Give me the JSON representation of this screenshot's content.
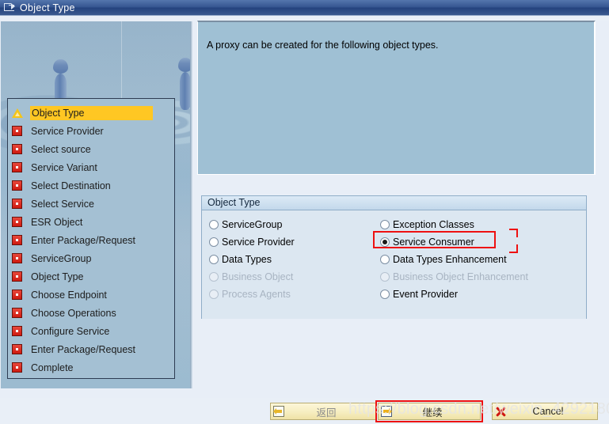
{
  "window": {
    "title": "Object Type",
    "title_icon": "document-arrow-icon"
  },
  "description": {
    "text": "A proxy can be created for the following object types."
  },
  "sidebar": {
    "steps": [
      {
        "label": "Object Type",
        "icon": "warning-triangle-icon",
        "state": "current"
      },
      {
        "label": "Service Provider",
        "icon": "red-square-icon",
        "state": "pending"
      },
      {
        "label": "Select source",
        "icon": "red-square-icon",
        "state": "pending"
      },
      {
        "label": "Service Variant",
        "icon": "red-square-icon",
        "state": "pending"
      },
      {
        "label": "Select Destination",
        "icon": "red-square-icon",
        "state": "pending"
      },
      {
        "label": "Select Service",
        "icon": "red-square-icon",
        "state": "pending"
      },
      {
        "label": "ESR Object",
        "icon": "red-square-icon",
        "state": "pending"
      },
      {
        "label": "Enter Package/Request",
        "icon": "red-square-icon",
        "state": "pending"
      },
      {
        "label": "ServiceGroup",
        "icon": "red-square-icon",
        "state": "pending"
      },
      {
        "label": "Object Type",
        "icon": "red-square-icon",
        "state": "pending"
      },
      {
        "label": "Choose Endpoint",
        "icon": "red-square-icon",
        "state": "pending"
      },
      {
        "label": "Choose Operations",
        "icon": "red-square-icon",
        "state": "pending"
      },
      {
        "label": "Configure Service",
        "icon": "red-square-icon",
        "state": "pending"
      },
      {
        "label": "Enter Package/Request",
        "icon": "red-square-icon",
        "state": "pending"
      },
      {
        "label": "Complete",
        "icon": "red-square-icon",
        "state": "pending"
      }
    ]
  },
  "object_type_group": {
    "title": "Object Type",
    "left_options": [
      {
        "label": "ServiceGroup",
        "selected": false,
        "disabled": false
      },
      {
        "label": "Service Provider",
        "selected": false,
        "disabled": false
      },
      {
        "label": "Data Types",
        "selected": false,
        "disabled": false
      },
      {
        "label": "Business Object",
        "selected": false,
        "disabled": true
      },
      {
        "label": "Process Agents",
        "selected": false,
        "disabled": true
      }
    ],
    "right_options": [
      {
        "label": "Exception Classes",
        "selected": false,
        "disabled": false
      },
      {
        "label": "Service Consumer",
        "selected": true,
        "disabled": false
      },
      {
        "label": "Data Types Enhancement",
        "selected": false,
        "disabled": false
      },
      {
        "label": "Business Object Enhancement",
        "selected": false,
        "disabled": true
      },
      {
        "label": "Event Provider",
        "selected": false,
        "disabled": false
      }
    ]
  },
  "buttons": {
    "back": {
      "label": "返回",
      "icon": "back-arrow-icon"
    },
    "continue": {
      "label": "继续",
      "icon": "forward-arrow-icon"
    },
    "cancel": {
      "label": "Cancel",
      "icon": "cancel-x-icon"
    }
  },
  "watermark": {
    "text": "https://blog.csdn.net/weixin_42921800"
  },
  "colors": {
    "titlebar": "#355590",
    "panel_blue": "#9fc0d4",
    "highlight_yellow": "#ffc723",
    "accent_red": "#ee1111",
    "button_yellow": "#f6eec0"
  }
}
